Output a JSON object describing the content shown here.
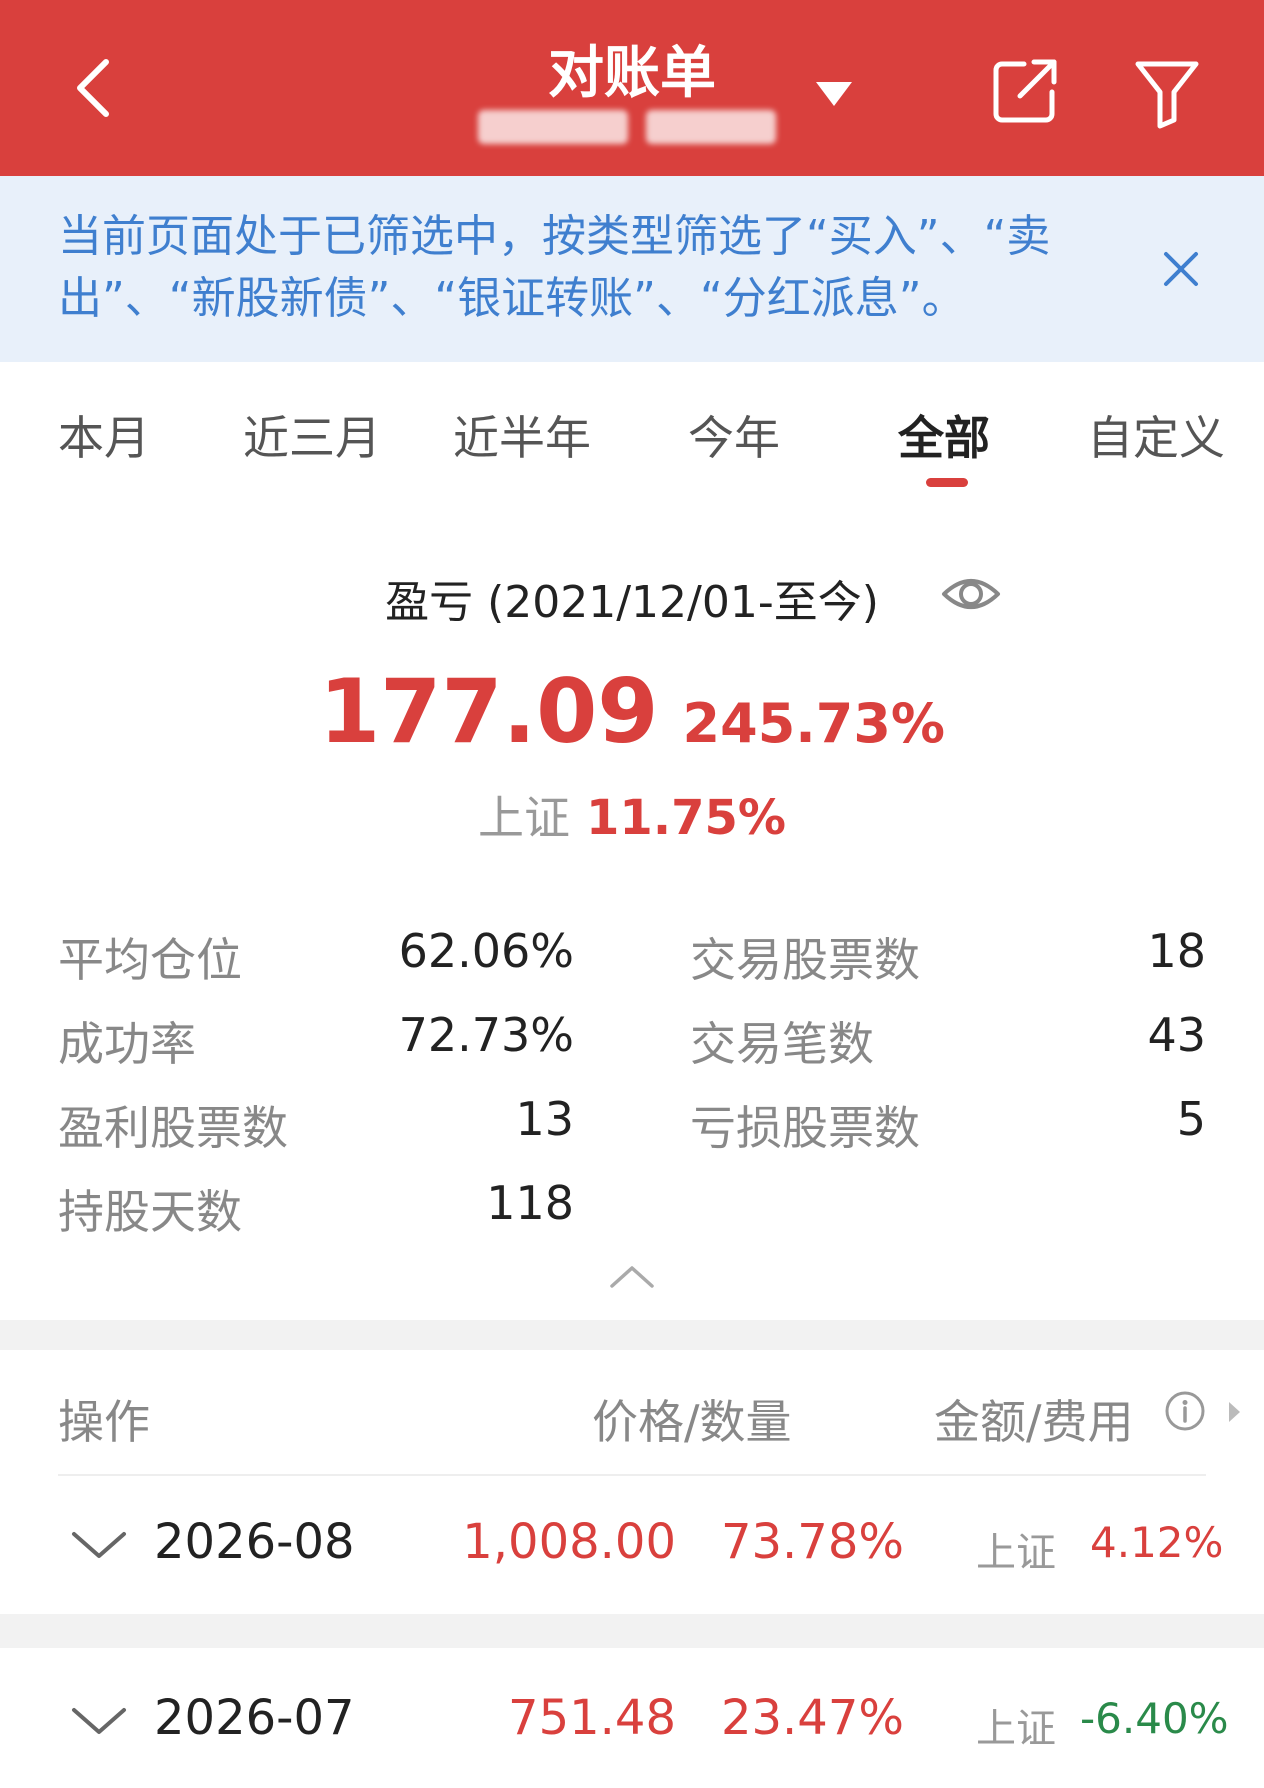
{
  "header": {
    "title": "对账单",
    "back_icon": "chevron-left-icon",
    "dropdown_icon": "triangle-down-icon",
    "share_icon": "share-icon",
    "filter_icon": "filter-icon",
    "background": "#d9403d"
  },
  "notice": {
    "text": "当前页面处于已筛选中，按类型筛选了“买入”、“卖出”、“新股新债”、“银证转账”、“分红派息”。",
    "color": "#3f7fcf",
    "background": "#e8f0fa"
  },
  "tabs": [
    {
      "label": "本月",
      "active": false
    },
    {
      "label": "近三月",
      "active": false
    },
    {
      "label": "近半年",
      "active": false
    },
    {
      "label": "今年",
      "active": false
    },
    {
      "label": "全部",
      "active": true
    },
    {
      "label": "自定义",
      "active": false
    }
  ],
  "summary": {
    "period_label": "盈亏 (2021/12/01-至今)",
    "profit": "177.09",
    "profit_pct": "245.73%",
    "benchmark_label": "上证",
    "benchmark_value": "11.75%"
  },
  "stats": {
    "left": [
      {
        "label": "平均仓位",
        "value": "62.06%"
      },
      {
        "label": "成功率",
        "value": "72.73%"
      },
      {
        "label": "盈利股票数",
        "value": "13"
      },
      {
        "label": "持股天数",
        "value": "118"
      }
    ],
    "right": [
      {
        "label": "交易股票数",
        "value": "18"
      },
      {
        "label": "交易笔数",
        "value": "43"
      },
      {
        "label": "亏损股票数",
        "value": "5"
      }
    ]
  },
  "table": {
    "headers": [
      "操作",
      "价格/数量",
      "金额/费用"
    ],
    "rows": [
      {
        "date": "2026-08",
        "amount": "1,008.00",
        "pct": "73.78%",
        "benchmark_label": "上证",
        "benchmark_value": "4.12%",
        "benchmark_negative": false
      },
      {
        "date": "2026-07",
        "amount": "751.48",
        "pct": "23.47%",
        "benchmark_label": "上证",
        "benchmark_value": "-6.40%",
        "benchmark_negative": true
      }
    ]
  },
  "colors": {
    "accent_red": "#d9403d",
    "negative_green": "#2a8a4a"
  }
}
